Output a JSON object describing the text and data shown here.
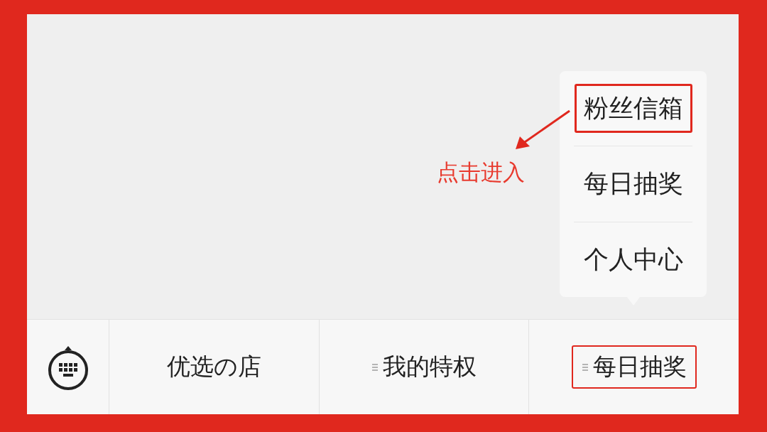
{
  "submenu": {
    "items": [
      {
        "label": "粉丝信箱",
        "highlighted": true
      },
      {
        "label": "每日抽奖",
        "highlighted": false
      },
      {
        "label": "个人中心",
        "highlighted": false
      }
    ]
  },
  "annotation": {
    "label": "点击进入"
  },
  "menu_bar": {
    "buttons": [
      {
        "label": "优选の店",
        "has_submenu": false,
        "highlighted": false
      },
      {
        "label": "我的特权",
        "has_submenu": true,
        "highlighted": false
      },
      {
        "label": "每日抽奖",
        "has_submenu": true,
        "highlighted": true
      }
    ]
  }
}
